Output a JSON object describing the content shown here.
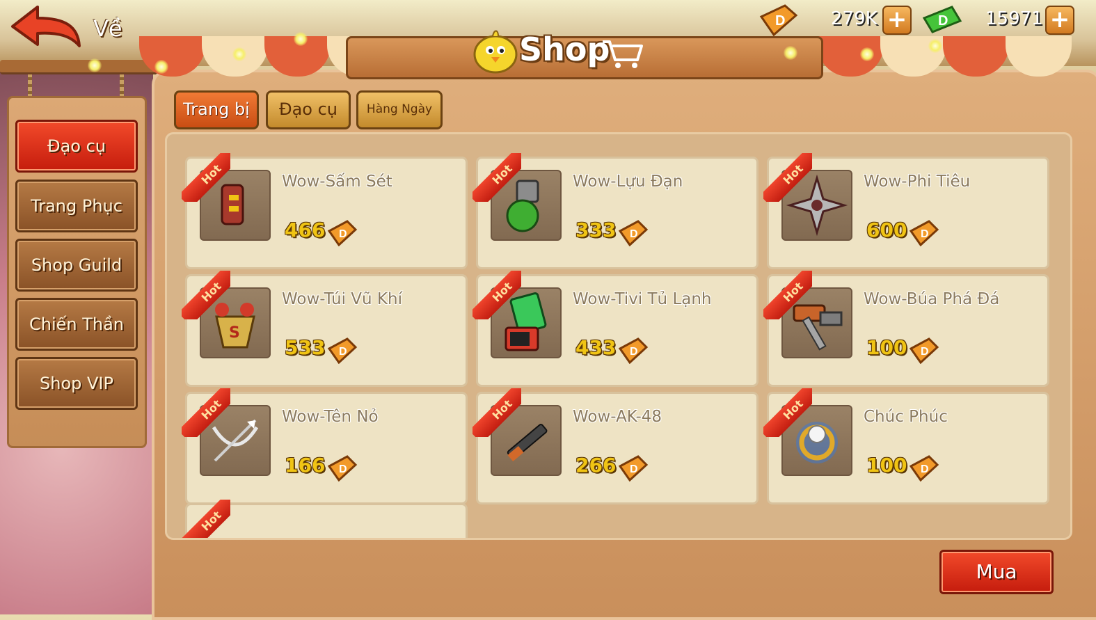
{
  "header": {
    "back_label": "Về",
    "title": "Shop"
  },
  "currency": {
    "gold": "279K",
    "cash": "15971",
    "plus": "+"
  },
  "sidebar": {
    "items": [
      {
        "label": "Đạo cụ",
        "active": true
      },
      {
        "label": "Trang Phục",
        "active": false
      },
      {
        "label": "Shop Guild",
        "active": false
      },
      {
        "label": "Chiến Thần",
        "active": false
      },
      {
        "label": "Shop VIP",
        "active": false
      }
    ]
  },
  "tabs": [
    {
      "label": "Trang bị",
      "active": true
    },
    {
      "label": "Đạo cụ",
      "active": false
    },
    {
      "label": "Hàng Ngày",
      "active": false
    }
  ],
  "hot_label": "Hot",
  "items": [
    {
      "name": "Wow-Sấm Sét",
      "price": "466",
      "icon": "lightning-gun-icon"
    },
    {
      "name": "Wow-Lựu Đạn",
      "price": "333",
      "icon": "grenade-icon"
    },
    {
      "name": "Wow-Phi Tiêu",
      "price": "600",
      "icon": "shuriken-icon"
    },
    {
      "name": "Wow-Túi Vũ Khí",
      "price": "533",
      "icon": "weapon-bag-icon"
    },
    {
      "name": "Wow-Tivi Tủ Lạnh",
      "price": "433",
      "icon": "tv-fridge-icon"
    },
    {
      "name": "Wow-Búa Phá Đá",
      "price": "100",
      "icon": "hammer-icon"
    },
    {
      "name": "Wow-Tên Nỏ",
      "price": "166",
      "icon": "crossbow-icon"
    },
    {
      "name": "Wow-AK-48",
      "price": "266",
      "icon": "rifle-icon"
    },
    {
      "name": "Chúc Phúc",
      "price": "100",
      "icon": "ring-icon"
    }
  ],
  "buy_label": "Mua",
  "colors": {
    "accent_red": "#e0321c",
    "price_gold": "#f0c414",
    "wood": "#c98f5b"
  }
}
